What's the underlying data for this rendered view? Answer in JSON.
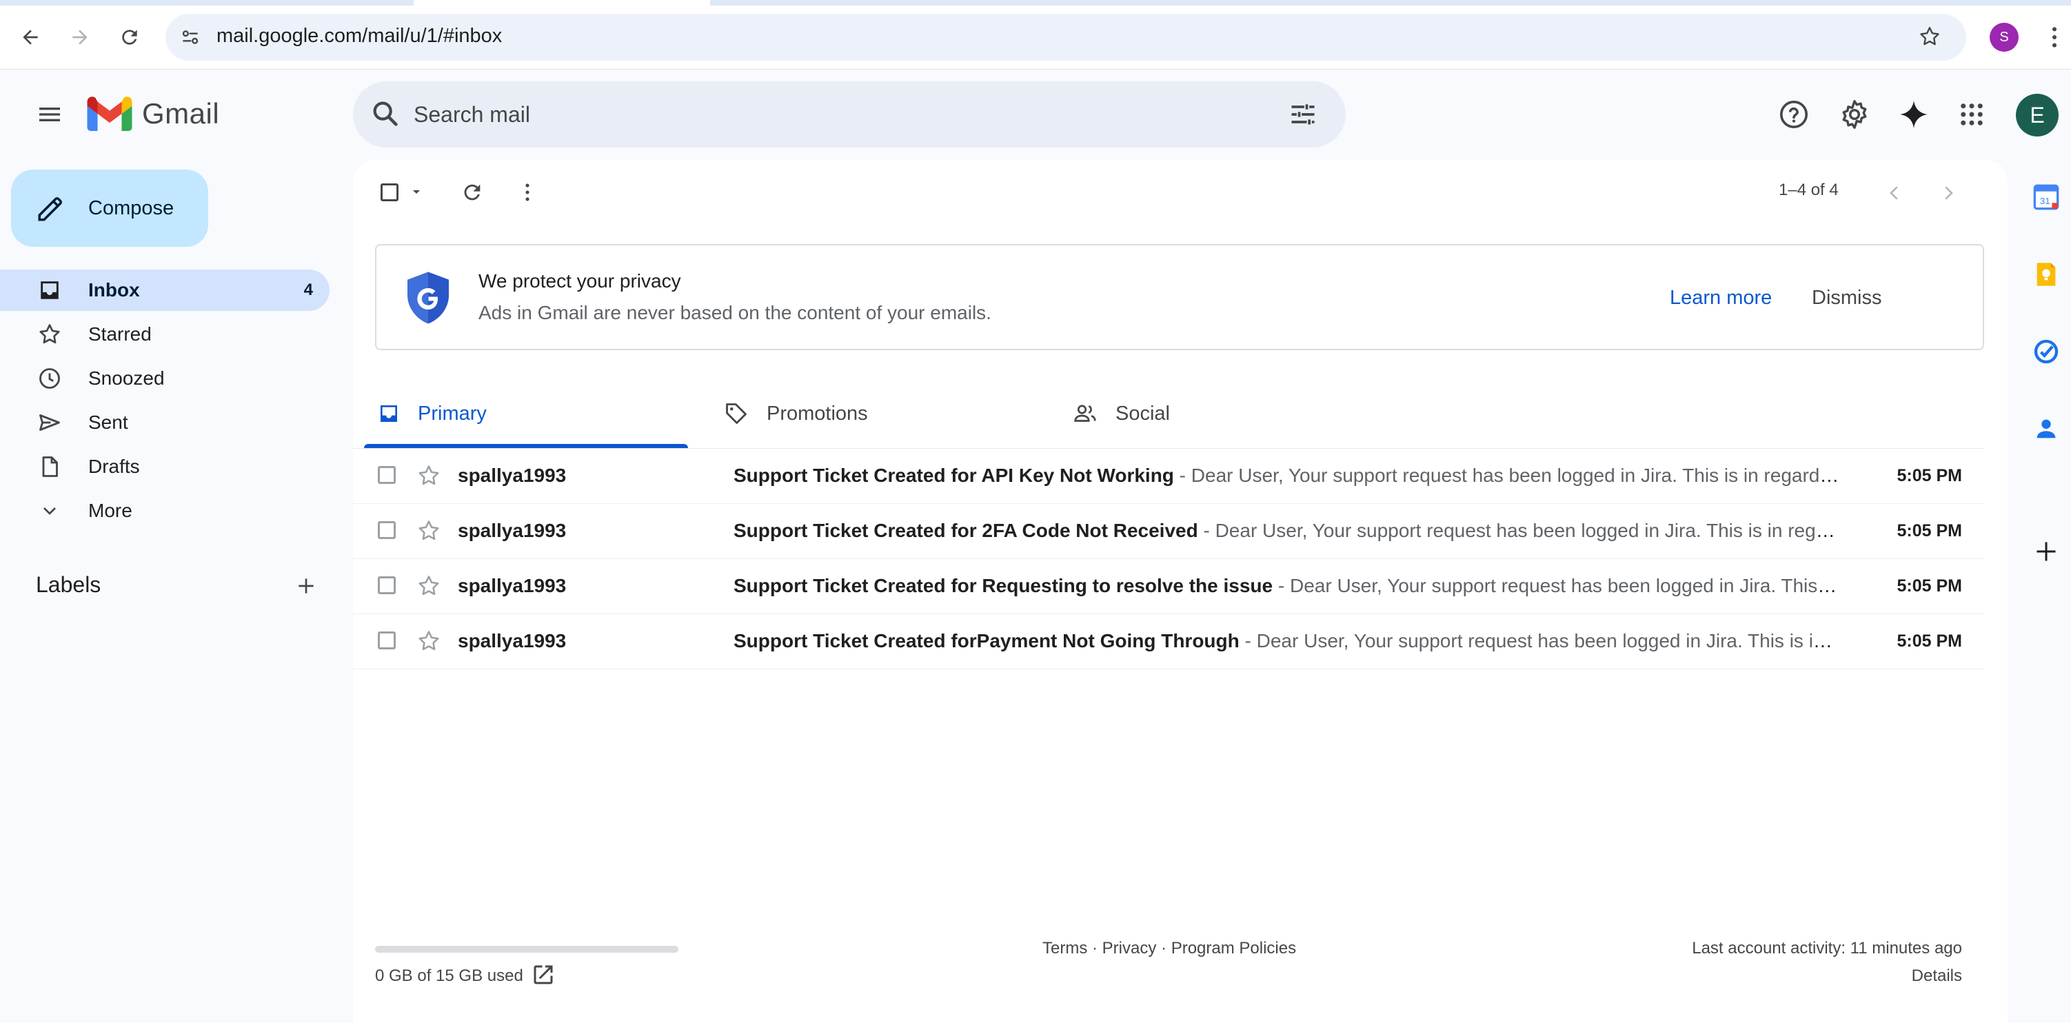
{
  "browser": {
    "url": "mail.google.com/mail/u/1/#inbox",
    "profile_initial": "S"
  },
  "app": {
    "name": "Gmail",
    "account_initial": "E"
  },
  "search": {
    "placeholder": "Search mail"
  },
  "sidebar": {
    "compose_label": "Compose",
    "items": [
      {
        "label": "Inbox",
        "count": "4",
        "icon": "inbox-icon",
        "active": true
      },
      {
        "label": "Starred",
        "icon": "star-icon"
      },
      {
        "label": "Snoozed",
        "icon": "clock-icon"
      },
      {
        "label": "Sent",
        "icon": "send-icon"
      },
      {
        "label": "Drafts",
        "icon": "draft-icon"
      },
      {
        "label": "More",
        "icon": "chevron-down-icon"
      }
    ],
    "labels_heading": "Labels"
  },
  "toolbar": {
    "paging": "1–4 of 4"
  },
  "privacy_banner": {
    "title": "We protect your privacy",
    "subtitle": "Ads in Gmail are never based on the content of your emails.",
    "learn_more": "Learn more",
    "dismiss": "Dismiss"
  },
  "tabs": [
    {
      "label": "Primary",
      "icon": "inbox-icon",
      "active": true
    },
    {
      "label": "Promotions",
      "icon": "tag-icon"
    },
    {
      "label": "Social",
      "icon": "people-icon"
    }
  ],
  "emails": [
    {
      "sender": "spallya1993",
      "subject": "Support Ticket Created for API Key Not Working",
      "snippet": " - Dear User, Your support request has been logged in Jira. This is in regard to your ticket regarding the issue.",
      "time": "5:05 PM"
    },
    {
      "sender": "spallya1993",
      "subject": "Support Ticket Created for 2FA Code Not Received",
      "snippet": " - Dear User, Your support request has been logged in Jira. This is in regard to your ticket regarding the issue.",
      "time": "5:05 PM"
    },
    {
      "sender": "spallya1993",
      "subject": "Support Ticket Created for Requesting to resolve the issue",
      "snippet": " - Dear User, Your support request has been logged in Jira. This is in regard to your ticket regarding the issue.",
      "time": "5:05 PM"
    },
    {
      "sender": "spallya1993",
      "subject": "Support Ticket Created forPayment Not Going Through",
      "snippet": " - Dear User, Your support request has been logged in Jira. This is in regard to your ticket regarding the issue.",
      "time": "5:05 PM"
    }
  ],
  "footer": {
    "storage": "0 GB of 15 GB used",
    "storage_fraction": 0,
    "terms": "Terms",
    "privacy": "Privacy",
    "policies": "Program Policies",
    "sep": " · ",
    "last_activity": "Last account activity: 11 minutes ago",
    "details": "Details"
  },
  "side_panel": {
    "calendar_day": "31"
  },
  "colors": {
    "accent": "#0b57d0",
    "compose_bg": "#c2e7ff",
    "active_nav_bg": "#d3e3fd",
    "page_bg": "#f8fafd"
  }
}
